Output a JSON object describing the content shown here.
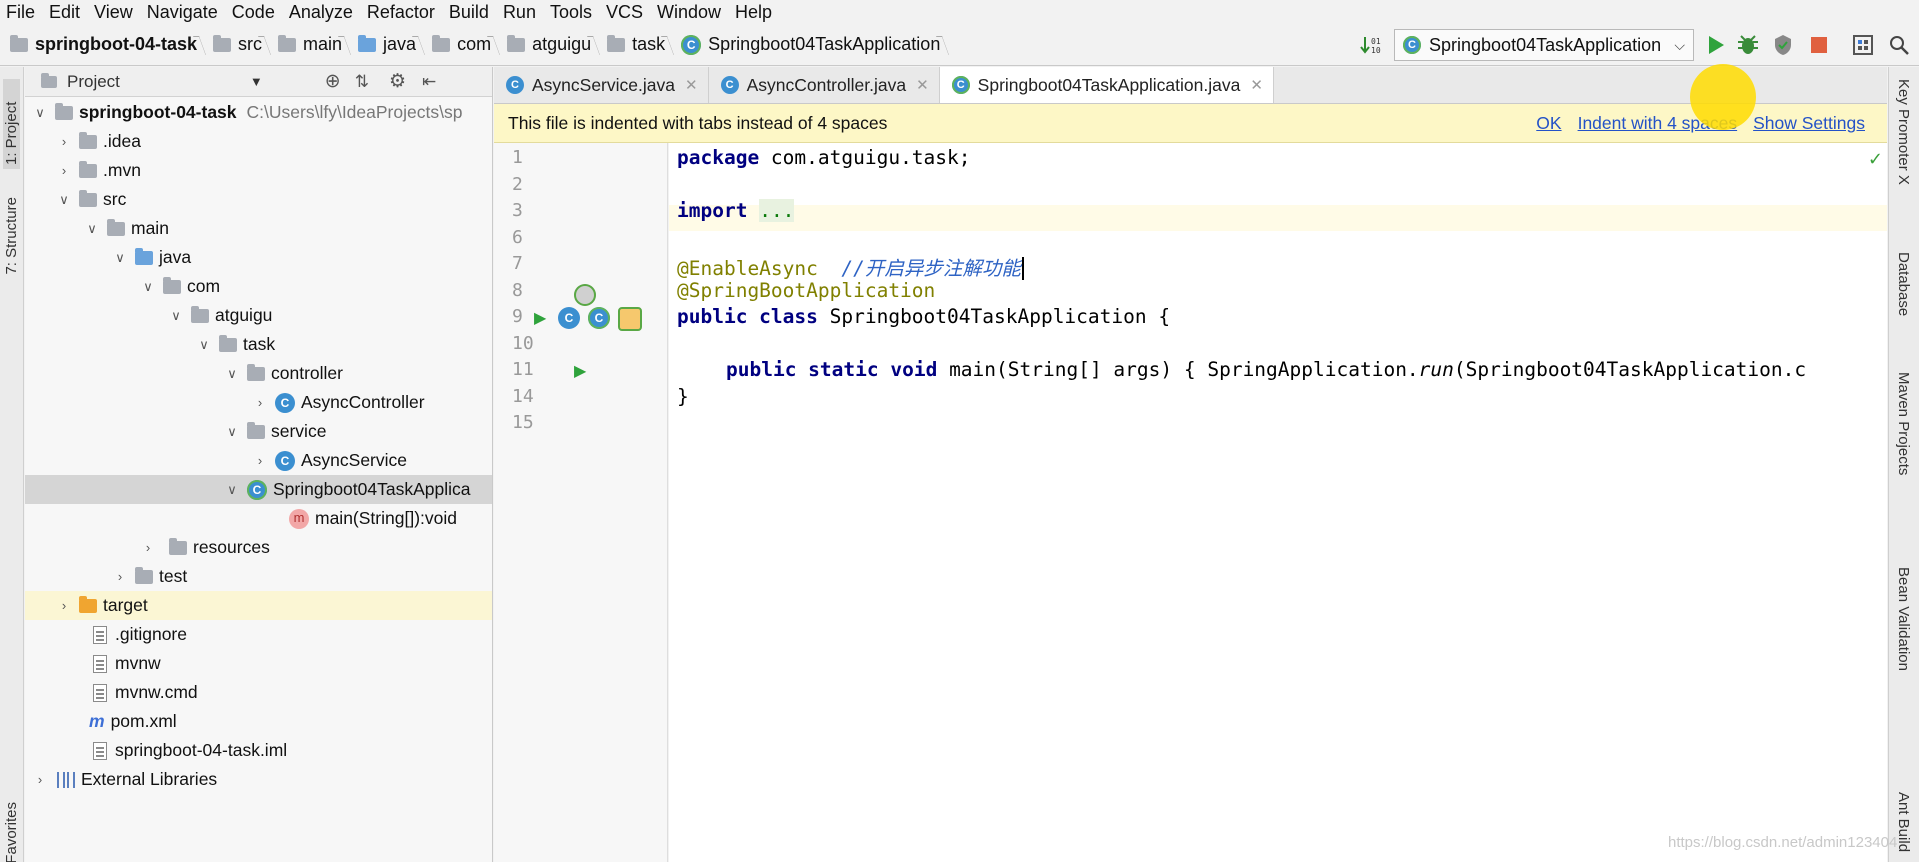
{
  "menu": [
    "File",
    "Edit",
    "View",
    "Navigate",
    "Code",
    "Analyze",
    "Refactor",
    "Build",
    "Run",
    "Tools",
    "VCS",
    "Window",
    "Help"
  ],
  "breadcrumb": [
    "springboot-04-task",
    "src",
    "main",
    "java",
    "com",
    "atguigu",
    "task",
    "Springboot04TaskApplication"
  ],
  "run_config": "Springboot04TaskApplication",
  "left_stripe": {
    "project": "1: Project",
    "structure": "7: Structure",
    "favorites": "Favorites"
  },
  "project_panel": {
    "title": "Project",
    "root_name": "springboot-04-task",
    "root_path": "C:\\Users\\lfy\\IdeaProjects\\sp",
    "items": {
      "idea": ".idea",
      "mvn": ".mvn",
      "src": "src",
      "main": "main",
      "java": "java",
      "com": "com",
      "atguigu": "atguigu",
      "task": "task",
      "controller": "controller",
      "async_controller": "AsyncController",
      "service": "service",
      "async_service": "AsyncService",
      "app": "Springboot04TaskApplica",
      "main_method": "main(String[]):void",
      "resources": "resources",
      "test": "test",
      "target": "target",
      "gitignore": ".gitignore",
      "mvnw": "mvnw",
      "mvnw_cmd": "mvnw.cmd",
      "pom": "pom.xml",
      "iml": "springboot-04-task.iml",
      "ext_libs": "External Libraries"
    }
  },
  "tabs": [
    "AsyncService.java",
    "AsyncController.java",
    "Springboot04TaskApplication.java"
  ],
  "notice": {
    "message": "This file is indented with tabs instead of 4 spaces",
    "ok": "OK",
    "indent": "Indent with 4 spaces",
    "settings": "Show Settings"
  },
  "line_numbers": [
    "1",
    "2",
    "3",
    "6",
    "7",
    "8",
    "9",
    "10",
    "11",
    "14",
    "15"
  ],
  "code": {
    "l1_kw": "package",
    "l1_rest": " com.atguigu.task;",
    "l3_kw": "import",
    "l3_dots": "...",
    "l7_ann": "@EnableAsync",
    "l7_cmt": "//开启异步注解功能",
    "l8_ann": "@SpringBootApplication",
    "l9_kw": "public class",
    "l9_rest": " Springboot04TaskApplication {",
    "l11_kw": "public static void",
    "l11_rest": " main(String[] args) { SpringApplication.",
    "l11_run": "run",
    "l11_tail": "(Springboot04TaskApplication.c",
    "l14": "}"
  },
  "right_stripe": [
    "Key Promoter X",
    "Database",
    "Maven Projects",
    "Bean Validation",
    "Ant Build"
  ],
  "watermark": "https://blog.csdn.net/admin123404",
  "colors": {
    "notice_bg": "#fdf7c6",
    "keyword": "#000080",
    "annotation": "#808000",
    "comment": "#2e63c4",
    "link": "#2452c7"
  }
}
